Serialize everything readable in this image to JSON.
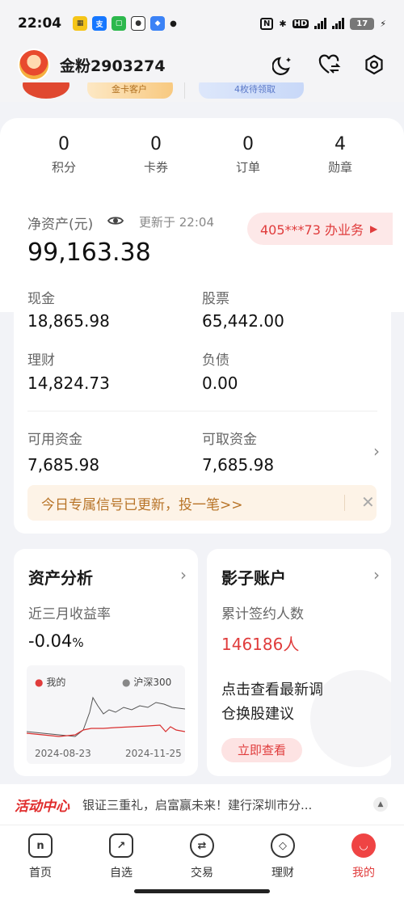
{
  "status": {
    "time": "22:04",
    "battery": "17"
  },
  "header": {
    "username": "金粉2903274"
  },
  "badges": {
    "pill1": "金卡客户",
    "pill2": "4枚待领取"
  },
  "stats": [
    {
      "value": "0",
      "label": "积分"
    },
    {
      "value": "0",
      "label": "卡券"
    },
    {
      "value": "0",
      "label": "订单"
    },
    {
      "value": "4",
      "label": "勋章"
    }
  ],
  "assets": {
    "title": "净资产(元)",
    "updated": "更新于 22:04",
    "account_btn": "405***73 办业务",
    "total": "99,163.38",
    "items": [
      {
        "label": "现金",
        "value": "18,865.98"
      },
      {
        "label": "股票",
        "value": "65,442.00"
      },
      {
        "label": "理财",
        "value": "14,824.73"
      },
      {
        "label": "负债",
        "value": "0.00"
      }
    ],
    "available_label": "可用资金",
    "available_value": "7,685.98",
    "withdraw_label": "可取资金",
    "withdraw_value": "7,685.98",
    "notice": "今日专属信号已更新，投一笔>>"
  },
  "analysis": {
    "title": "资产分析",
    "subtitle": "近三月收益率",
    "rate": "-0.04",
    "rate_unit": "%",
    "legend_mine": "我的",
    "legend_index": "沪深300",
    "date_start": "2024-08-23",
    "date_end": "2024-11-25"
  },
  "shadow": {
    "title": "影子账户",
    "subtitle": "累计签约人数",
    "count": "146186人",
    "desc_line1": "点击查看最新调",
    "desc_line2": "仓换股建议",
    "btn": "立即查看"
  },
  "activity": {
    "logo": "活动中心",
    "text": "银证三重礼，启富赢未来！建行深圳市分..."
  },
  "tabs": [
    {
      "label": "首页",
      "icon": "home-icon"
    },
    {
      "label": "自选",
      "icon": "watchlist-icon"
    },
    {
      "label": "交易",
      "icon": "trade-icon"
    },
    {
      "label": "理财",
      "icon": "wealth-icon"
    },
    {
      "label": "我的",
      "icon": "profile-icon"
    }
  ],
  "colors": {
    "accent": "#e03c3c",
    "notice": "#b87428"
  }
}
